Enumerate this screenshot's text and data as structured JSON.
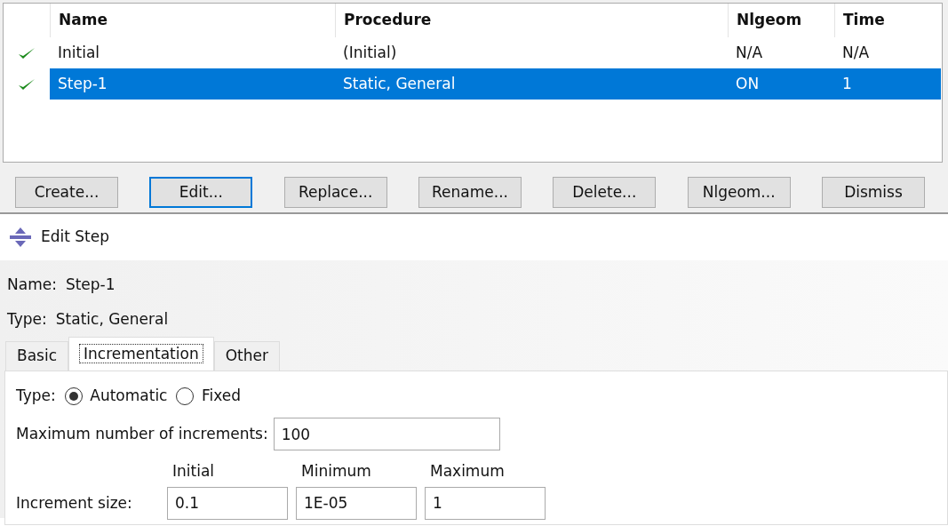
{
  "steps_table": {
    "columns": [
      "Name",
      "Procedure",
      "Nlgeom",
      "Time"
    ],
    "rows": [
      {
        "done": true,
        "selected": false,
        "cells": [
          "Initial",
          "(Initial)",
          "N/A",
          "N/A"
        ]
      },
      {
        "done": true,
        "selected": true,
        "cells": [
          "Step-1",
          "Static, General",
          "ON",
          "1"
        ]
      }
    ]
  },
  "manager_buttons": [
    {
      "label": "Create...",
      "focused": false
    },
    {
      "label": "Edit...",
      "focused": true
    },
    {
      "label": "Replace...",
      "focused": false
    },
    {
      "label": "Rename...",
      "focused": false
    },
    {
      "label": "Delete...",
      "focused": false
    },
    {
      "label": "Nlgeom...",
      "focused": false
    },
    {
      "label": "Dismiss",
      "focused": false
    }
  ],
  "dialog": {
    "title": "Edit Step",
    "name_label": "Name:",
    "name_value": "Step-1",
    "type_label": "Type:",
    "type_value": "Static, General",
    "tabs": [
      {
        "label": "Basic",
        "selected": false
      },
      {
        "label": "Incrementation",
        "selected": true
      },
      {
        "label": "Other",
        "selected": false
      }
    ],
    "incrementation": {
      "type_label": "Type:",
      "type_options": [
        {
          "label": "Automatic",
          "selected": true
        },
        {
          "label": "Fixed",
          "selected": false
        }
      ],
      "max_increments_label": "Maximum number of increments:",
      "max_increments_value": "100",
      "size_headings": [
        "Initial",
        "Minimum",
        "Maximum"
      ],
      "size_label": "Increment size:",
      "size_values": [
        "0.1",
        "1E-05",
        "1"
      ]
    }
  }
}
